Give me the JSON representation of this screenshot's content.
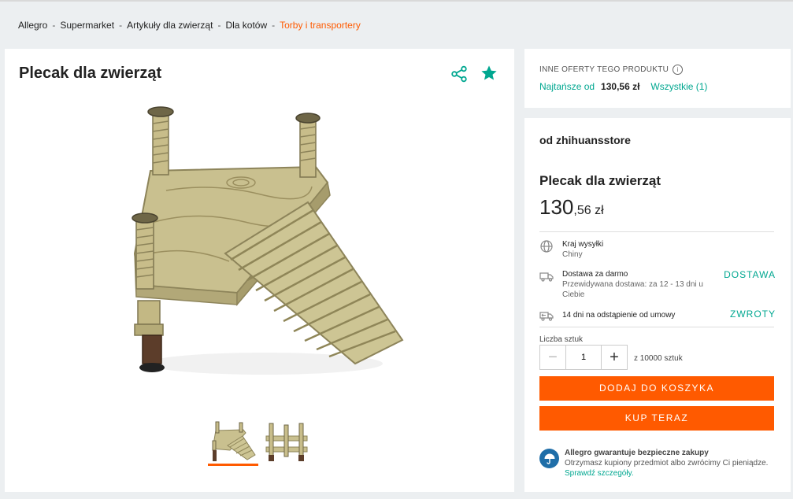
{
  "breadcrumb": {
    "items": [
      "Allegro",
      "Supermarket",
      "Artykuły dla zwierząt",
      "Dla kotów"
    ],
    "current": "Torby i transportery",
    "separator": "-"
  },
  "product": {
    "title": "Plecak dla zwierząt",
    "thumbnails": [
      "ramp-thumbnail",
      "side-view-thumbnail"
    ]
  },
  "other_offers": {
    "heading": "INNE OFERTY TEGO PRODUKTU",
    "cheapest_label": "Najtańsze od",
    "cheapest_price": "130,56 zł",
    "all_label": "Wszystkie (1)"
  },
  "buy_box": {
    "seller": "od zhihuansstore",
    "title": "Plecak dla zwierząt",
    "price_int": "130",
    "price_dec": ",56 zł",
    "ship_country_label": "Kraj wysyłki",
    "ship_country": "Chiny",
    "delivery_label": "Dostawa za darmo",
    "delivery_estimate": "Przewidywana dostawa: za 12 - 13 dni u Ciebie",
    "delivery_link": "DOSTAWA",
    "returns_label": "14 dni na odstąpienie od umowy",
    "returns_link": "ZWROTY",
    "qty_label": "Liczba sztuk",
    "qty_value": "1",
    "qty_of": "z 10000 sztuk",
    "add_to_cart": "DODAJ DO KOSZYKA",
    "buy_now": "KUP TERAZ",
    "guarantee_title": "Allegro gwarantuje bezpieczne zakupy",
    "guarantee_text": "Otrzymasz kupiony przedmiot albo zwrócimy Ci pieniądze.",
    "guarantee_link": "Sprawdź szczegóły."
  },
  "colors": {
    "accent_orange": "#ff5a00",
    "accent_green": "#00a790",
    "background": "#eceff1"
  }
}
